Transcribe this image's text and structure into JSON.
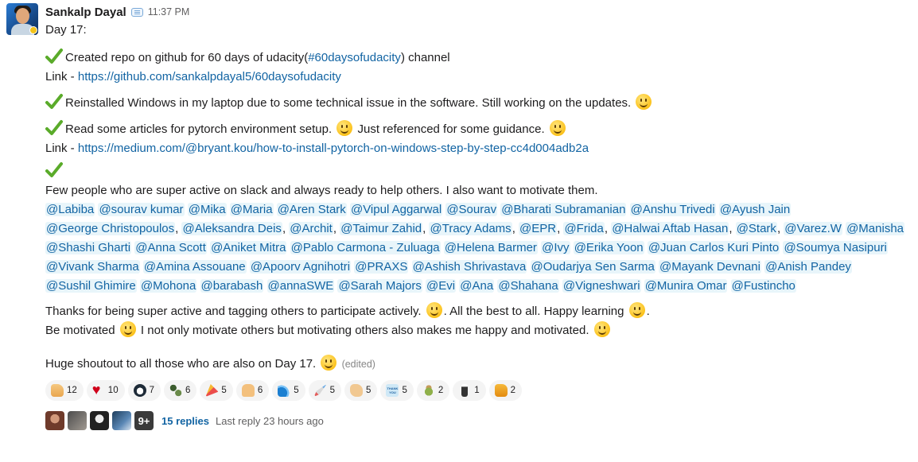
{
  "message": {
    "author": "Sankalp Dayal",
    "time": "11:37 PM",
    "title": "Day 17",
    "title_suffix": ":",
    "item1": {
      "text_before": "Created repo on github for 60 days of udacity(",
      "hashtag": "#60daysofudacity",
      "text_after": ")  channel",
      "link_label": "Link - ",
      "link": "https://github.com/sankalpdayal5/60daysofudacity"
    },
    "item2": {
      "text": "Reinstalled Windows in my laptop due to some technical issue in the software. Still working on the updates."
    },
    "item3": {
      "text_a": "Read some articles for pytorch environment setup.",
      "text_b": "Just referenced for some guidance.",
      "link_label": "Link -  ",
      "link": "https://medium.com/@bryant.kou/how-to-install-pytorch-on-windows-step-by-step-cc4d004adb2a"
    },
    "item4": {
      "text": "Few people who are super active on slack and always ready to help others. I also want to motivate them."
    },
    "mentions": [
      "@Labiba",
      "@sourav kumar",
      "@Mika",
      "@Maria",
      "@Aren Stark",
      "@Vipul Aggarwal",
      "@Sourav",
      "@Bharati Subramanian",
      "@Anshu Trivedi",
      "@Ayush Jain",
      "@George Christopoulos",
      "@Aleksandra Deis",
      "@Archit",
      "@Taimur Zahid",
      "@Tracy Adams",
      "@EPR",
      "@Frida",
      "@Halwai Aftab Hasan",
      "@Stark",
      "@Varez.W",
      "@Manisha",
      "@Shashi Gharti",
      "@Anna Scott",
      "@Aniket Mitra",
      "@Pablo Carmona - Zuluaga",
      "@Helena Barmer",
      "@Ivy",
      "@Erika Yoon",
      "@Juan Carlos Kuri Pinto",
      "@Soumya Nasipuri",
      "@Vivank Sharma",
      "@Amina Assouane",
      "@Apoorv Agnihotri",
      "@PRAXS",
      "@Ashish Shrivastava",
      "@Oudarjya Sen Sarma",
      "@Mayank Devnani",
      "@Anish Pandey",
      "@Sushil Ghimire",
      "@Mohona",
      "@barabash",
      "@annaSWE",
      "@Sarah Majors",
      "@Evi",
      "@Ana",
      "@Shahana",
      "@Vigneshwari",
      "@Munira Omar",
      "@Fustincho"
    ],
    "thanks_a": "Thanks for being super active and tagging others to participate actively.",
    "thanks_b": ". All the best to all. Happy learning",
    "thanks_c": ".",
    "motivated_a": "Be motivated",
    "motivated_b": "I not only motivate others but motivating others also makes me happy and motivated.",
    "shoutout": "Huge shoutout to all those who are also on Day 17.",
    "edited": "(edited)"
  },
  "reactions": [
    {
      "icon": "thumbsup-icon",
      "count": "12"
    },
    {
      "icon": "heart-icon",
      "count": "10"
    },
    {
      "icon": "penguin-icon",
      "count": "7"
    },
    {
      "icon": "dancers-icon",
      "count": "6"
    },
    {
      "icon": "party-icon",
      "count": "5"
    },
    {
      "icon": "raised-hands-icon",
      "count": "6"
    },
    {
      "icon": "wave-icon",
      "count": "5"
    },
    {
      "icon": "rocket-icon",
      "count": "5"
    },
    {
      "icon": "clap-icon",
      "count": "5"
    },
    {
      "icon": "thank-you-icon",
      "count": "5"
    },
    {
      "icon": "teddy-bear-icon",
      "count": "2"
    },
    {
      "icon": "person-icon",
      "count": "1"
    },
    {
      "icon": "thumbsup-yellow-icon",
      "count": "2"
    }
  ],
  "thread": {
    "more_count": "9+",
    "replies": "15 replies",
    "last_reply": "Last reply 23 hours ago"
  }
}
